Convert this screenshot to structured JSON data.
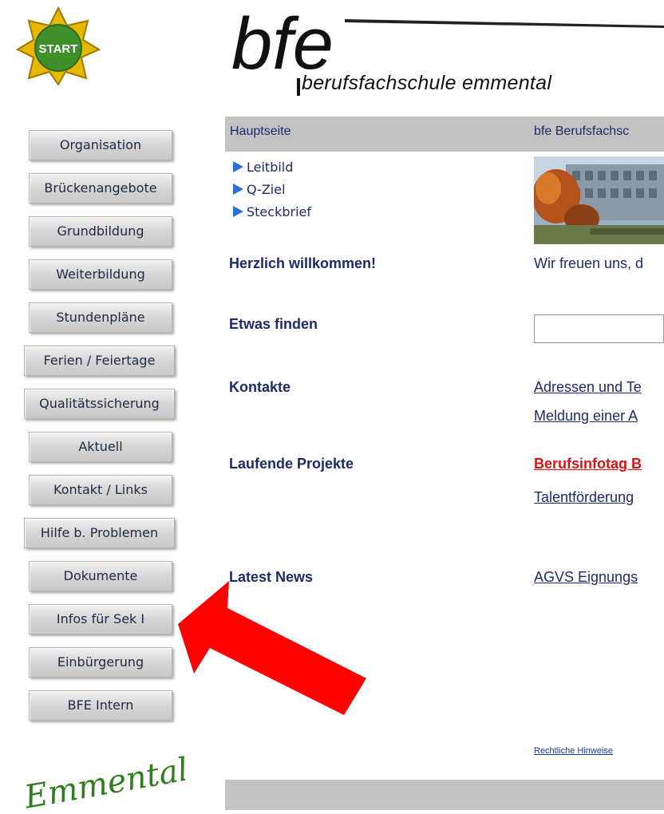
{
  "start_button": {
    "label": "START"
  },
  "logo": {
    "wordmark": "bfe",
    "subtitle": "berufsfachschule emmental"
  },
  "nav": [
    "Organisation",
    "Brückenangebote",
    "Grundbildung",
    "Weiterbildung",
    "Stundenpläne",
    "Ferien / Feiertage",
    "Qualitätssicherung",
    "Aktuell",
    "Kontakt / Links",
    "Hilfe b. Problemen",
    "Dokumente",
    "Infos für Sek I",
    "Einbürgerung",
    "BFE Intern"
  ],
  "footer_logo": {
    "text": "Emmental"
  },
  "header": {
    "left": "Hauptseite",
    "right": "bfe Berufsfachsc"
  },
  "sub_links": [
    "Leitbild",
    "Q-Ziel",
    "Steckbrief"
  ],
  "sections": {
    "welcome": {
      "label": "Herzlich willkommen!",
      "text": "Wir freuen uns, d"
    },
    "search": {
      "label": "Etwas finden",
      "value": ""
    },
    "contacts": {
      "label": "Kontakte",
      "links": [
        "Adressen und Te",
        "Meldung einer A"
      ]
    },
    "projects": {
      "label": "Laufende Projekte",
      "links": [
        "Berufsinfotag B",
        "Talentförderung"
      ]
    },
    "news": {
      "label": "Latest News",
      "links": [
        "AGVS Eignungs"
      ]
    }
  },
  "legal_link": "Rechtliche Hinweise",
  "colors": {
    "accent_text": "#1f2a6b",
    "highlight_link": "#e01010",
    "annotation_arrow": "#ff0000",
    "bar_gray": "#c3c3c3"
  }
}
